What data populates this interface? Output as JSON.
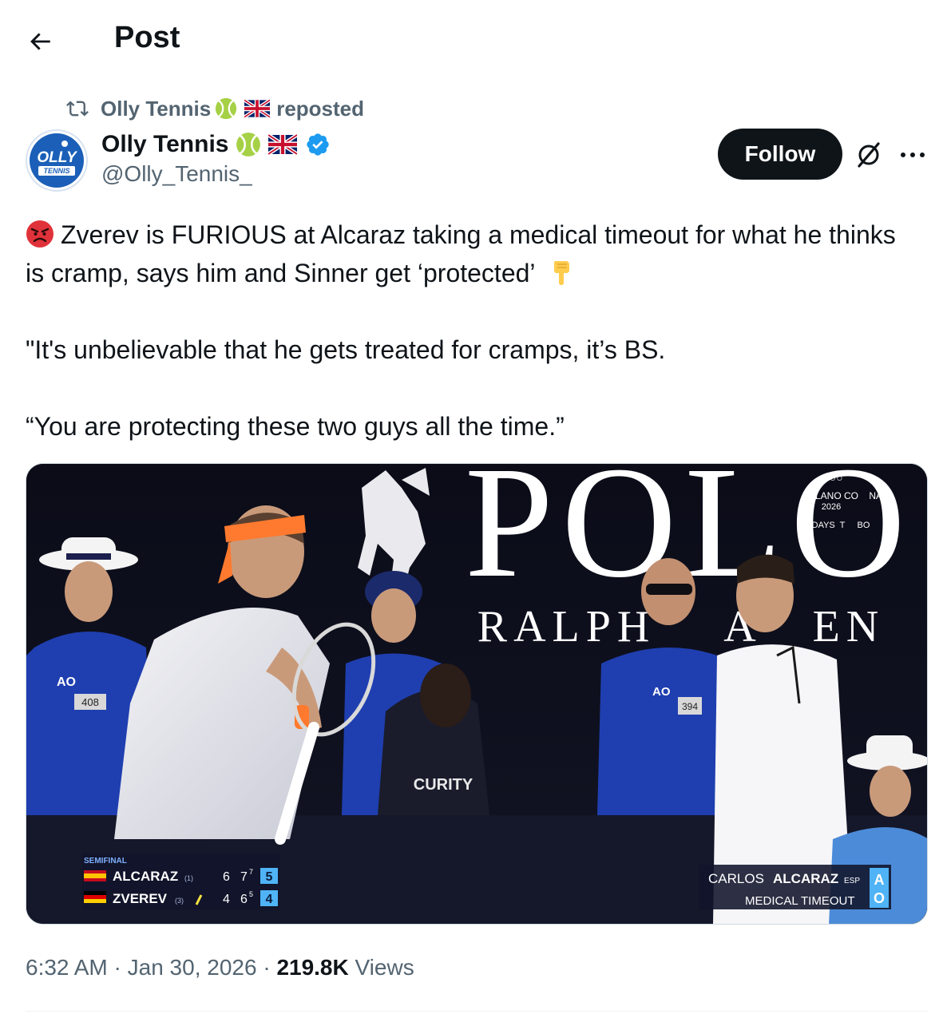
{
  "header": {
    "title": "Post"
  },
  "repost": {
    "name": "Olly Tennis",
    "suffix": "reposted"
  },
  "author": {
    "avatar_text_top": "OLLY",
    "avatar_text_bottom": "TENNIS",
    "name": "Olly Tennis",
    "handle": "@Olly_Tennis_"
  },
  "actions": {
    "follow_label": "Follow"
  },
  "tweet": {
    "paragraph1": "Zverev is FURIOUS at Alcaraz taking a medical timeout for what he thinks is cramp, says him and Sinner get ‘protected’",
    "paragraph2": "\"It's unbelievable that he gets treated for cramps, it’s BS.",
    "paragraph3": "“You are protecting these two guys all the time.”"
  },
  "media": {
    "sponsor_top": "POLO",
    "sponsor_bottom": "RALPH    A   EN",
    "olympic_line1": "LANO CO    NA",
    "olympic_line2": "2026",
    "olympic_line3": "DAYS  T     BO",
    "security_text": "CURITY",
    "badge_left": "408",
    "badge_right": "394",
    "scoreboard": {
      "round": "SEMIFINAL",
      "rows": [
        {
          "player": "ALCARAZ",
          "seed": "(1)",
          "set1": "6",
          "set2": "7",
          "set2_sup": "7",
          "current": "5"
        },
        {
          "player": "ZVEREV",
          "seed": "(3)",
          "set1": "4",
          "set2": "6",
          "set2_sup": "5",
          "current": "4"
        }
      ]
    },
    "caption": {
      "first": "CARLOS",
      "last": "ALCARAZ",
      "country": "ESP",
      "status": "MEDICAL TIMEOUT"
    }
  },
  "meta": {
    "time": "6:32 AM",
    "date": "Jan 30, 2026",
    "views_count": "219.8K",
    "views_label": "Views",
    "separator": "·"
  }
}
